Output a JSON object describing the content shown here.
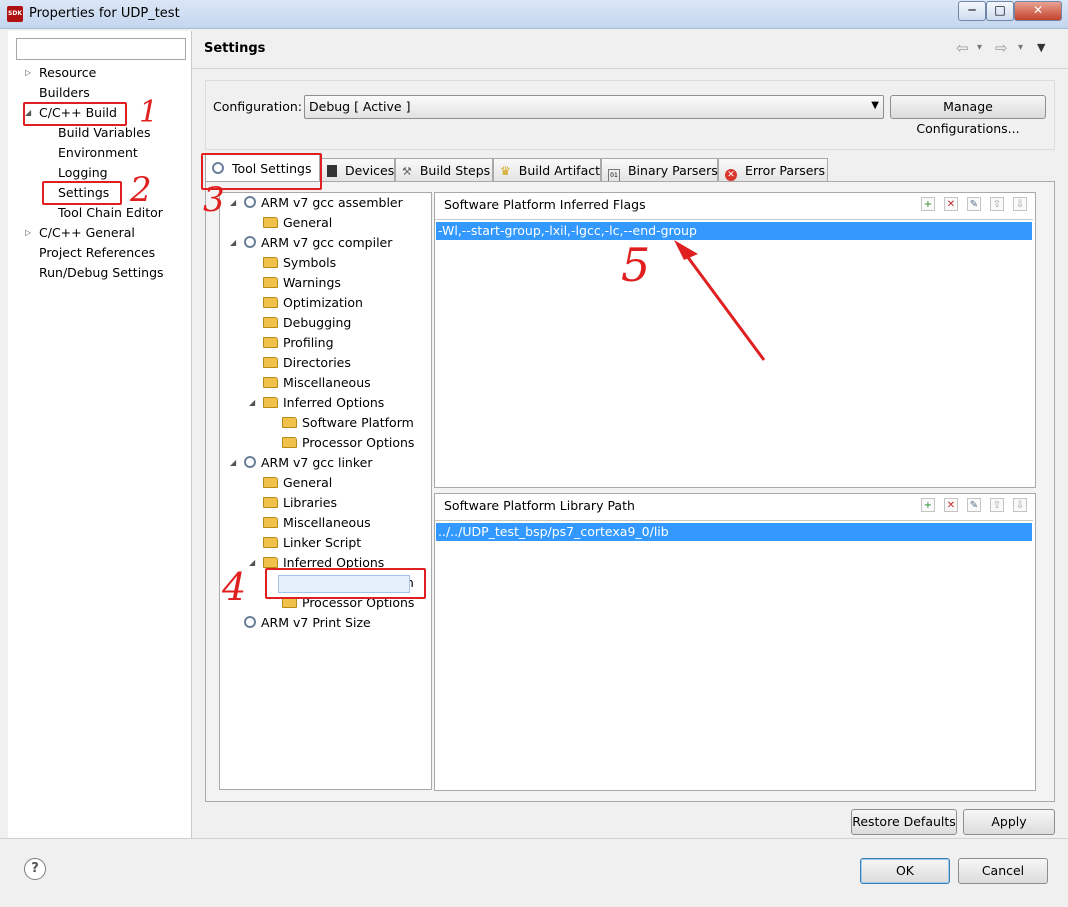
{
  "window": {
    "title": "Properties for UDP_test",
    "icon_text": "SDK",
    "buttons": {
      "minimize": "─",
      "maximize": "□",
      "close": "✕"
    }
  },
  "left_nav": {
    "filter_value": "",
    "items": [
      {
        "label": "Resource",
        "indent": 0,
        "expander": "▷"
      },
      {
        "label": "Builders",
        "indent": 0,
        "expander": ""
      },
      {
        "label": "C/C++ Build",
        "indent": 0,
        "expander": "◢"
      },
      {
        "label": "Build Variables",
        "indent": 1,
        "expander": ""
      },
      {
        "label": "Environment",
        "indent": 1,
        "expander": ""
      },
      {
        "label": "Logging",
        "indent": 1,
        "expander": ""
      },
      {
        "label": "Settings",
        "indent": 1,
        "expander": ""
      },
      {
        "label": "Tool Chain Editor",
        "indent": 1,
        "expander": ""
      },
      {
        "label": "C/C++ General",
        "indent": 0,
        "expander": "▷"
      },
      {
        "label": "Project References",
        "indent": 0,
        "expander": ""
      },
      {
        "label": "Run/Debug Settings",
        "indent": 0,
        "expander": ""
      }
    ]
  },
  "page": {
    "heading": "Settings",
    "nav_icons": {
      "back": "⇦",
      "forward": "⇨",
      "dropdown": "▾",
      "menu": "▼"
    }
  },
  "configuration": {
    "label": "Configuration:",
    "value": "Debug  [ Active ]",
    "manage_button": "Manage Configurations..."
  },
  "tabs": [
    {
      "label": "Tool Settings",
      "icon": "gear-icon"
    },
    {
      "label": "Devices",
      "icon": "chip-icon"
    },
    {
      "label": "Build Steps",
      "icon": "wrench-icon"
    },
    {
      "label": "Build Artifact",
      "icon": "trophy-icon"
    },
    {
      "label": "Binary Parsers",
      "icon": "binary-icon"
    },
    {
      "label": "Error Parsers",
      "icon": "error-icon"
    }
  ],
  "tool_tree": [
    {
      "label": "ARM v7 gcc assembler",
      "level": 0,
      "icon": "gear",
      "expander": "◢"
    },
    {
      "label": "General",
      "level": 1,
      "icon": "folder",
      "expander": ""
    },
    {
      "label": "ARM v7 gcc compiler",
      "level": 0,
      "icon": "gear",
      "expander": "◢"
    },
    {
      "label": "Symbols",
      "level": 1,
      "icon": "folder",
      "expander": ""
    },
    {
      "label": "Warnings",
      "level": 1,
      "icon": "folder",
      "expander": ""
    },
    {
      "label": "Optimization",
      "level": 1,
      "icon": "folder",
      "expander": ""
    },
    {
      "label": "Debugging",
      "level": 1,
      "icon": "folder",
      "expander": ""
    },
    {
      "label": "Profiling",
      "level": 1,
      "icon": "folder",
      "expander": ""
    },
    {
      "label": "Directories",
      "level": 1,
      "icon": "folder",
      "expander": ""
    },
    {
      "label": "Miscellaneous",
      "level": 1,
      "icon": "folder",
      "expander": ""
    },
    {
      "label": "Inferred Options",
      "level": 1,
      "icon": "folder",
      "expander": "◢"
    },
    {
      "label": "Software Platform",
      "level": 2,
      "icon": "folder",
      "expander": ""
    },
    {
      "label": "Processor Options",
      "level": 2,
      "icon": "folder",
      "expander": ""
    },
    {
      "label": "ARM v7 gcc linker",
      "level": 0,
      "icon": "gear",
      "expander": "◢"
    },
    {
      "label": "General",
      "level": 1,
      "icon": "folder",
      "expander": ""
    },
    {
      "label": "Libraries",
      "level": 1,
      "icon": "folder",
      "expander": ""
    },
    {
      "label": "Miscellaneous",
      "level": 1,
      "icon": "folder",
      "expander": ""
    },
    {
      "label": "Linker Script",
      "level": 1,
      "icon": "folder",
      "expander": ""
    },
    {
      "label": "Inferred Options",
      "level": 1,
      "icon": "folder",
      "expander": "◢"
    },
    {
      "label": "Software Platform",
      "level": 2,
      "icon": "folder",
      "expander": ""
    },
    {
      "label": "Processor Options",
      "level": 2,
      "icon": "folder",
      "expander": ""
    },
    {
      "label": "ARM v7 Print Size",
      "level": 0,
      "icon": "gear",
      "expander": ""
    }
  ],
  "flags_panel": {
    "title": "Software Platform Inferred Flags",
    "value": "-Wl,--start-group,-lxil,-lgcc,-lc,--end-group"
  },
  "library_panel": {
    "title": "Software Platform Library Path",
    "value": "../../UDP_test_bsp/ps7_cortexa9_0/lib"
  },
  "panel_toolbar_icons": [
    "add-icon",
    "delete-icon",
    "edit-icon",
    "move-up-icon",
    "move-down-icon"
  ],
  "annotations": [
    "1",
    "2",
    "3",
    "4",
    "5"
  ],
  "footer": {
    "restore_defaults": "Restore Defaults",
    "apply": "Apply",
    "ok": "OK",
    "cancel": "Cancel",
    "help": "?"
  },
  "colors": {
    "selection": "#3399ff",
    "annotation_red": "#e02020"
  }
}
